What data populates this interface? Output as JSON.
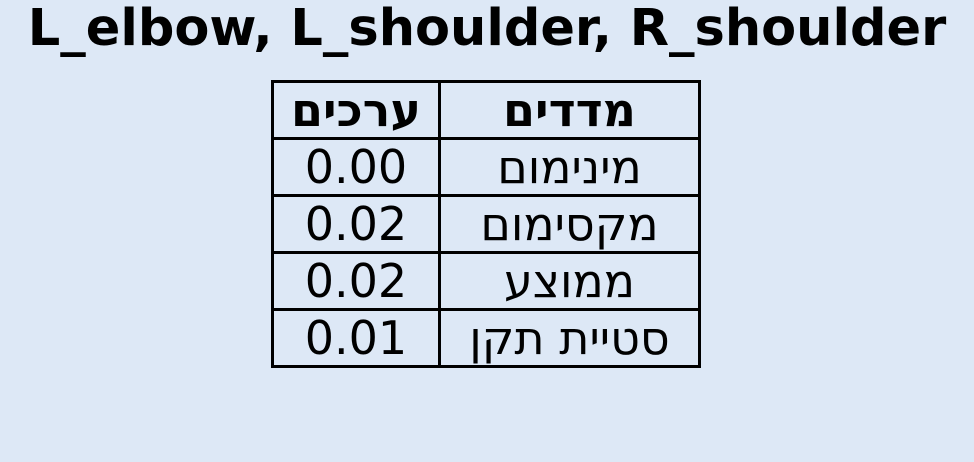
{
  "title": "L_elbow, L_shoulder, R_shoulder",
  "chart_data": {
    "type": "table",
    "title": "L_elbow, L_shoulder, R_shoulder",
    "columns": [
      "ערכים",
      "מדדים"
    ],
    "rows": [
      {
        "value": "0.00",
        "metric": "מינימום"
      },
      {
        "value": "0.02",
        "metric": "מקסימום"
      },
      {
        "value": "0.02",
        "metric": "ממוצע"
      },
      {
        "value": "0.01",
        "metric": "סטיית תקן"
      }
    ]
  }
}
